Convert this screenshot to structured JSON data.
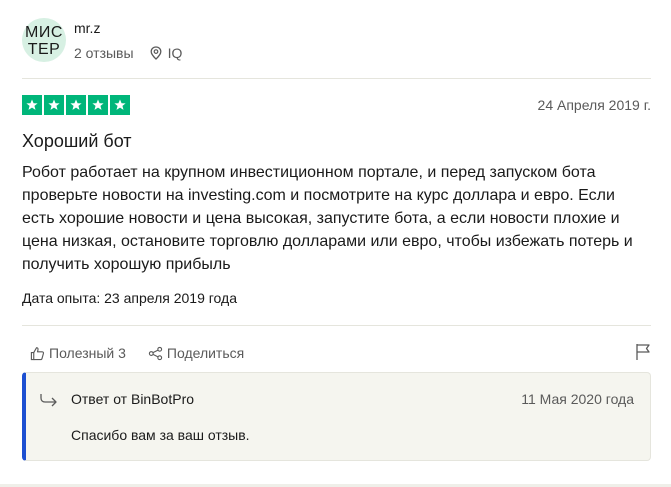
{
  "reviewer": {
    "avatar_initials": "МИСТЕР",
    "name": "mr.z",
    "reviews_count": "2 отзывы",
    "location": "IQ"
  },
  "review": {
    "rating": 5,
    "rating_max": 5,
    "star_color": "#00b67a",
    "date": "24 Апреля 2019 г.",
    "title": "Хороший бот",
    "body": "Робот работает на крупном инвестиционном портале, и перед запуском бота проверьте новости на investing.com и посмотрите на курс доллара и евро. Если есть хорошие новости и цена высокая, запустите бота, а если новости плохие и цена низкая, остановите торговлю долларами или евро, чтобы избежать потерь и получить хорошую прибыль",
    "experience_date": "Дата опыта: 23 апреля 2019 года"
  },
  "actions": {
    "useful_label": "Полезный 3",
    "share_label": "Поделиться",
    "flag_icon": "flag-icon"
  },
  "reply": {
    "from": "Ответ от BinBotPro",
    "date": "11 Мая 2020 года",
    "text": "Спасибо вам за ваш отзыв.",
    "accent_color": "#1c4fd1"
  }
}
